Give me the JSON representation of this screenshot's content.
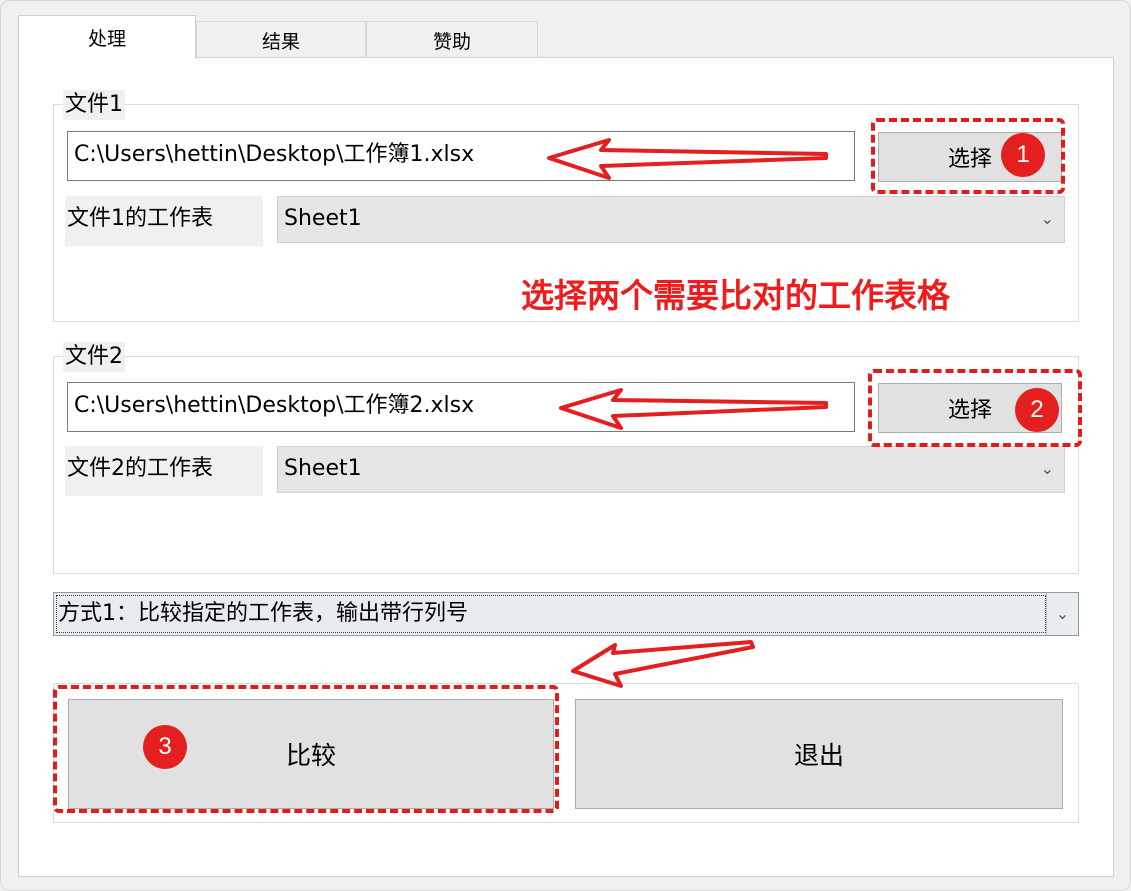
{
  "tabs": [
    {
      "label": "处理",
      "active": true
    },
    {
      "label": "结果",
      "active": false
    },
    {
      "label": "赞助",
      "active": false
    }
  ],
  "file1": {
    "legend": "文件1",
    "path": "C:\\Users\\hettin\\Desktop\\工作簿1.xlsx",
    "select_label": "选择",
    "sheet_label": "文件1的工作表",
    "sheet_value": "Sheet1"
  },
  "file2": {
    "legend": "文件2",
    "path": "C:\\Users\\hettin\\Desktop\\工作簿2.xlsx",
    "select_label": "选择",
    "sheet_label": "文件2的工作表",
    "sheet_value": "Sheet1"
  },
  "mode": {
    "value": "方式1：比较指定的工作表，输出带行列号"
  },
  "actions": {
    "compare_label": "比较",
    "exit_label": "退出"
  },
  "annotations": {
    "note": "选择两个需要比对的工作表格",
    "badge1": "1",
    "badge2": "2",
    "badge3": "3",
    "color": "#e41f1f"
  },
  "icons": {
    "dropdown": "chevron-down-icon"
  }
}
